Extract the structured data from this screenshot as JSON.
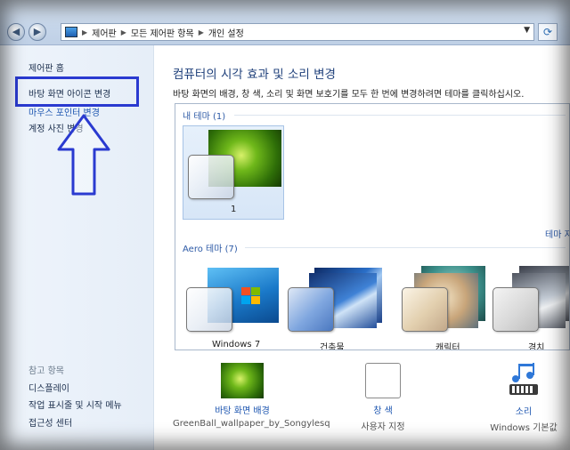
{
  "address_bar": {
    "path": [
      "제어판",
      "모든 제어판 항목",
      "개인 설정"
    ]
  },
  "sidebar": {
    "home": "제어판 홈",
    "links": [
      "바탕 화면 아이콘 변경",
      "마우스 포인터 변경",
      "계정 사진 변경"
    ],
    "see_also_title": "참고 항목",
    "see_also": [
      "디스플레이",
      "작업 표시줄 및 시작 메뉴",
      "접근성 센터"
    ]
  },
  "main": {
    "title": "컴퓨터의 시각 효과 및 소리 변경",
    "description": "바탕 화면의 배경, 창 색, 소리 및 화면 보호기를 모두 한 번에 변경하려면 테마를 클릭하십시오.",
    "my_themes_label": "내 테마 (1)",
    "my_theme_name": "1",
    "save_theme_link": "테마 저",
    "aero_label": "Aero 테마 (7)",
    "aero_themes": [
      "Windows 7",
      "건축물",
      "캐릭터",
      "경치"
    ]
  },
  "bottom": {
    "wallpaper_label": "바탕 화면 배경",
    "wallpaper_value": "GreenBall_wallpaper_by_Songylesq",
    "color_label": "창 색",
    "color_value": "사용자 지정",
    "sound_label": "소리",
    "sound_value": "Windows 기본값"
  },
  "colors": {
    "accent": "#1c55b0",
    "highlight_box": "#2a3ad0"
  }
}
